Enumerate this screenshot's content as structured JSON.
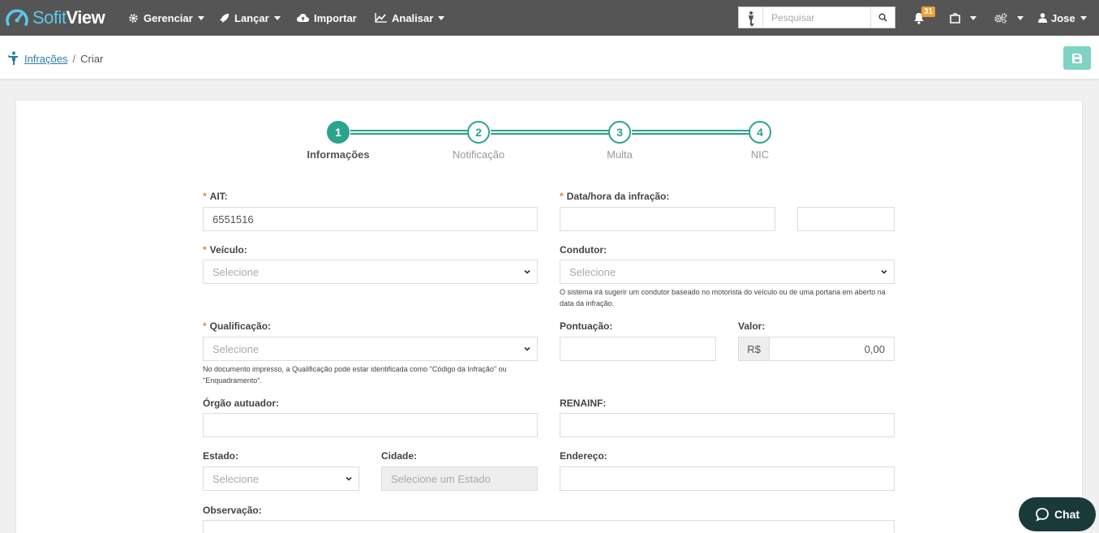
{
  "brand": {
    "part1": "Sofit",
    "part2": "View"
  },
  "nav": {
    "manage": "Gerenciar",
    "launch": "Lançar",
    "import": "Importar",
    "analyze": "Analisar",
    "search_placeholder": "Pesquisar",
    "notifications_count": "31",
    "user": "Jose"
  },
  "breadcrumb": {
    "parent": "Infrações",
    "separator": "/",
    "current": "Criar"
  },
  "stepper": {
    "steps": [
      {
        "number": "1",
        "label": "Informações",
        "active": true
      },
      {
        "number": "2",
        "label": "Notificação",
        "active": false
      },
      {
        "number": "3",
        "label": "Multa",
        "active": false
      },
      {
        "number": "4",
        "label": "NIC",
        "active": false
      }
    ]
  },
  "form": {
    "ait": {
      "label": "AIT:",
      "value": "6551516",
      "required": true
    },
    "datetime": {
      "label": "Data/hora da infração:",
      "required": true,
      "date_value": "",
      "time_value": ""
    },
    "vehicle": {
      "label": "Veículo:",
      "placeholder": "Selecione",
      "required": true
    },
    "driver": {
      "label": "Condutor:",
      "placeholder": "Selecione",
      "help": "O sistema irá sugerir um condutor baseado no motorista do veículo ou de uma portaria em aberto na data da infração."
    },
    "qualification": {
      "label": "Qualificação:",
      "placeholder": "Selecione",
      "required": true,
      "help": "No documento impresso, a Qualificação pode estar identificada como \"Código da Infração\" ou \"Enquadramento\"."
    },
    "points": {
      "label": "Pontuação:",
      "value": ""
    },
    "amount": {
      "label": "Valor:",
      "currency": "R$",
      "value": "0,00"
    },
    "agency": {
      "label": "Órgão autuador:",
      "value": ""
    },
    "renainf": {
      "label": "RENAINF:",
      "value": ""
    },
    "state": {
      "label": "Estado:",
      "placeholder": "Selecione"
    },
    "city": {
      "label": "Cidade:",
      "placeholder": "Selecione um Estado"
    },
    "address": {
      "label": "Endereço:",
      "value": ""
    },
    "notes": {
      "label": "Observação:"
    }
  },
  "chat": {
    "label": "Chat"
  },
  "colors": {
    "navbar": "#555555",
    "accent": "#2aa38f",
    "brand_blue": "#5bc8ea",
    "badge": "#f0a030",
    "required": "#e08a2a",
    "chat_bg": "#1a3a3a"
  }
}
